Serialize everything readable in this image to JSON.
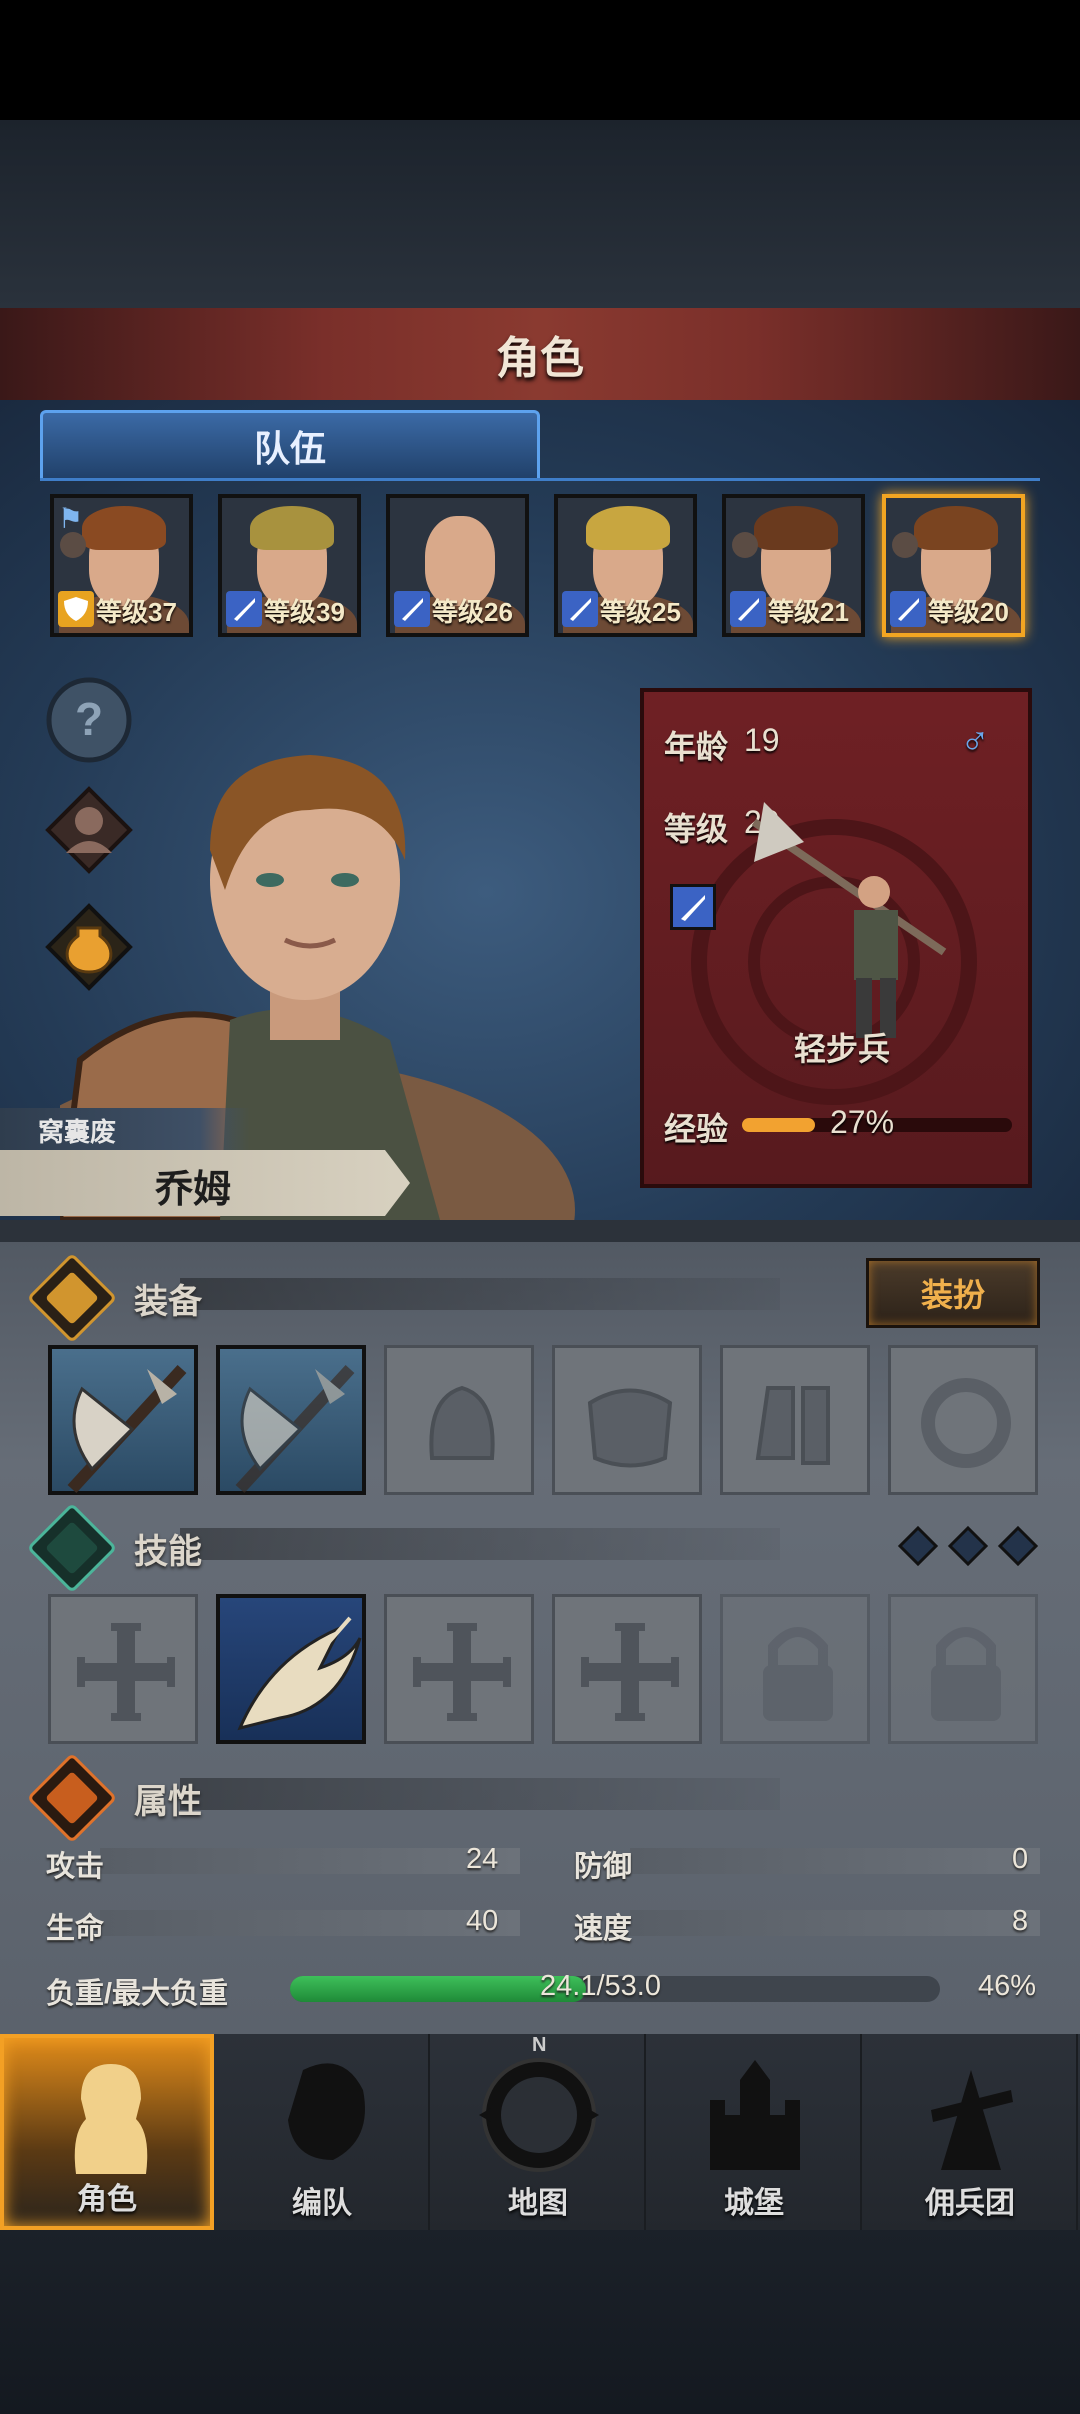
{
  "header": {
    "title": "角色"
  },
  "tabs": [
    {
      "label": "队伍"
    }
  ],
  "party": [
    {
      "level": "等级37",
      "role_icon": "shield-icon",
      "role_color": "#e8a320",
      "leader": true,
      "hair": "#8a4a22",
      "bald": false
    },
    {
      "level": "等级39",
      "role_icon": "sword-icon",
      "role_color": "#3b63c4",
      "leader": false,
      "hair": "#a8923e",
      "bald": false
    },
    {
      "level": "等级26",
      "role_icon": "sword-icon",
      "role_color": "#3b63c4",
      "leader": false,
      "hair": "#d7a48a",
      "bald": true
    },
    {
      "level": "等级25",
      "role_icon": "sword-icon",
      "role_color": "#3b63c4",
      "leader": false,
      "hair": "#c8a640",
      "bald": false
    },
    {
      "level": "等级21",
      "role_icon": "sword-icon",
      "role_color": "#3b63c4",
      "leader": false,
      "hair": "#6a3a1e",
      "bald": false
    },
    {
      "level": "等级20",
      "role_icon": "sword-icon",
      "role_color": "#3b63c4",
      "leader": false,
      "hair": "#7a4420",
      "bald": false,
      "selected": true
    }
  ],
  "side_icons": [
    "help-icon",
    "character-bust-icon",
    "potion-icon"
  ],
  "character": {
    "trait": "窝囊废",
    "name": "乔姆",
    "age_label": "年龄",
    "age": "19",
    "gender_symbol": "♂",
    "level_label": "等级",
    "level": "20",
    "class_name": "轻步兵",
    "exp_label": "经验",
    "exp_text": "27%",
    "exp_fraction": 0.27
  },
  "equipment": {
    "title": "装备",
    "dress_button": "装扮",
    "slots": [
      {
        "name": "axe-weapon-slot",
        "filled": true
      },
      {
        "name": "axe-offhand-slot",
        "filled": true,
        "dim": true
      },
      {
        "name": "helmet-slot",
        "filled": false
      },
      {
        "name": "armor-slot",
        "filled": false
      },
      {
        "name": "boots-slot",
        "filled": false
      },
      {
        "name": "ring-slot",
        "filled": false
      }
    ]
  },
  "skills": {
    "title": "技能",
    "slots": [
      "empty-cross",
      "eagle-skill",
      "empty-cross",
      "empty-cross",
      "locked",
      "locked"
    ]
  },
  "attributes": {
    "title": "属性",
    "attack_label": "攻击",
    "attack": "24",
    "defense_label": "防御",
    "defense": "0",
    "hp_label": "生命",
    "hp": "40",
    "speed_label": "速度",
    "speed": "8",
    "weight_label": "负重/最大负重",
    "weight_text": "24.1/53.0",
    "weight_fraction": 0.455,
    "weight_percent": "46%"
  },
  "nav": [
    {
      "label": "角色",
      "icon": "knight-icon",
      "active": true
    },
    {
      "label": "编队",
      "icon": "formation-icon",
      "active": false
    },
    {
      "label": "地图",
      "icon": "compass-map-icon",
      "active": false,
      "north": "N"
    },
    {
      "label": "城堡",
      "icon": "castle-icon",
      "active": false
    },
    {
      "label": "佣兵团",
      "icon": "mercenary-icon",
      "active": false
    }
  ]
}
